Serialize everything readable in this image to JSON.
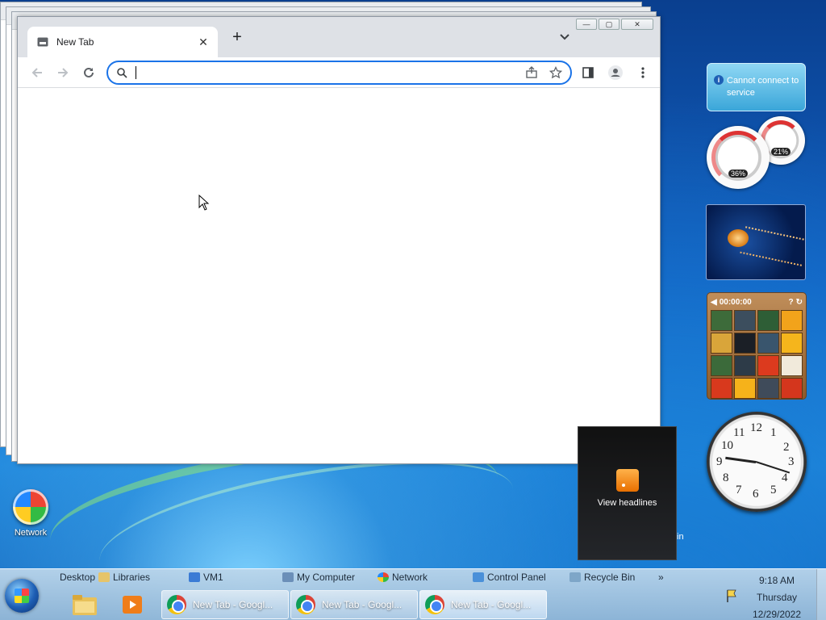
{
  "browser": {
    "tab_title": "New Tab",
    "new_tab_glyph": "+",
    "omnibox_value": "",
    "icons": [
      "back-icon",
      "forward-icon",
      "reload-icon",
      "search-icon",
      "share-icon",
      "bookmark-star-icon",
      "side-panel-icon",
      "profile-icon",
      "menu-icon"
    ]
  },
  "desktop": {
    "network_label": "Network"
  },
  "gadgets": {
    "weather_text": "Cannot connect to service",
    "cpu_meter_value": "36%",
    "memory_meter_value": "21%",
    "puzzle_timer": "00:00:00",
    "feed_label": "View headlines",
    "feed_overflow_text": "in",
    "clock_numbers": [
      "12",
      "1",
      "2",
      "3",
      "4",
      "5",
      "6",
      "7",
      "8",
      "9",
      "10",
      "11"
    ]
  },
  "taskbar": {
    "quick_links": [
      "Desktop",
      "Libraries",
      "VM1",
      "My Computer",
      "Network",
      "Control Panel",
      "Recycle Bin"
    ],
    "overflow_glyph": "»",
    "buttons": [
      "New Tab - Googl...",
      "New Tab - Googl...",
      "New Tab - Googl..."
    ],
    "clock_time": "9:18 AM",
    "clock_day": "Thursday",
    "clock_date": "12/29/2022"
  },
  "colors": {
    "omnibox_focus": "#1a73e8",
    "tab_strip": "#dee1e6"
  }
}
